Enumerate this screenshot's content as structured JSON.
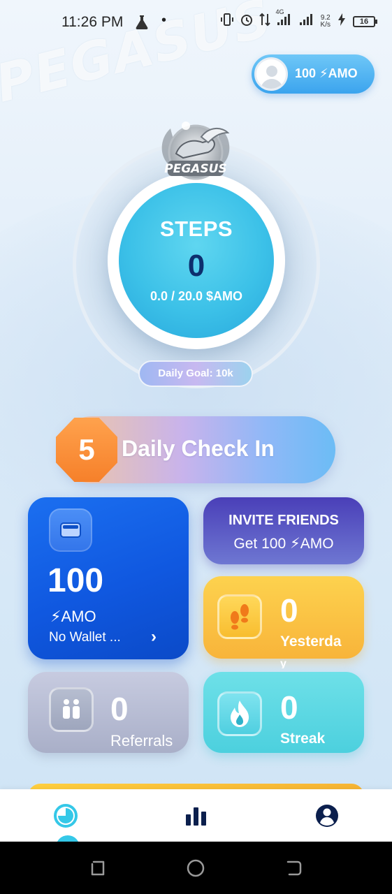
{
  "status_bar": {
    "time": "11:26 PM",
    "network": "4G",
    "speed_value": "9.2",
    "speed_unit": "K/s",
    "battery": "16"
  },
  "background": {
    "watermark": "PEGASUS"
  },
  "header": {
    "balance": "100 ⚡AMO"
  },
  "logo": {
    "text": "PEGASUS"
  },
  "steps": {
    "label": "STEPS",
    "value": "0",
    "amo_progress": "0.0 / 20.0 $AMO",
    "daily_goal": "Daily Goal: 10k"
  },
  "checkin": {
    "count": "5",
    "label": "Daily Check In"
  },
  "wallet_card": {
    "amount": "100",
    "unit": "⚡AMO",
    "status": "No Wallet ...",
    "chevron": "›"
  },
  "invite_card": {
    "title": "INVITE FRIENDS",
    "subtitle": "Get 100 ⚡AMO"
  },
  "yesterday_card": {
    "value": "0",
    "label": "Yesterda",
    "label_overflow": "y"
  },
  "referrals_card": {
    "value": "0",
    "label": "Referrals"
  },
  "streak_card": {
    "value": "0",
    "label": "Streak"
  },
  "colors": {
    "accent": "#35c8e8",
    "wallet_blue": "#1058e0",
    "invite_purple": "#4a3fb8",
    "yellow": "#f8b43a",
    "teal": "#4cd0de",
    "orange": "#f6802a",
    "nav_icon": "#0b1f4d"
  },
  "icons": {
    "flask": "flask-icon",
    "wallet": "wallet-icon",
    "footprints": "footprints-icon",
    "people": "people-icon",
    "flame": "flame-icon",
    "home": "home-pie-icon",
    "stats": "bar-chart-icon",
    "profile": "profile-icon"
  }
}
